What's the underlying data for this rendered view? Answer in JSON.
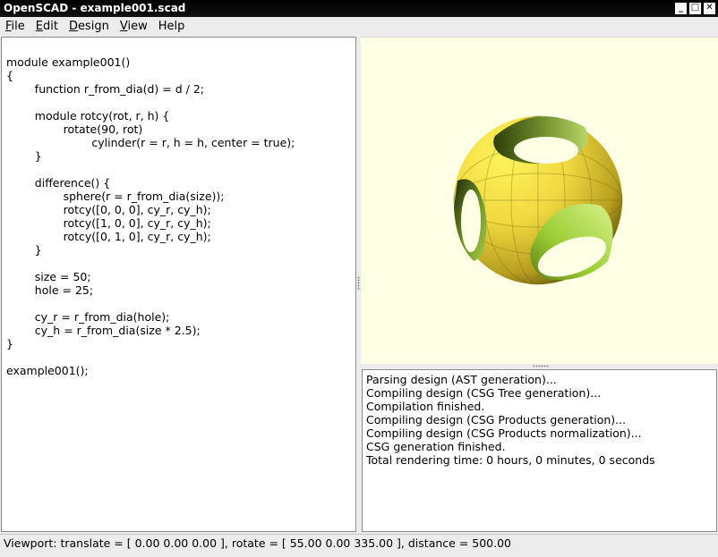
{
  "window": {
    "title": "OpenSCAD - example001.scad"
  },
  "window_controls": {
    "minimize": "_",
    "maximize": "□",
    "close": "✕"
  },
  "menu": [
    {
      "underline": "F",
      "rest": "ile"
    },
    {
      "underline": "E",
      "rest": "dit"
    },
    {
      "underline": "D",
      "rest": "esign"
    },
    {
      "underline": "V",
      "rest": "iew"
    },
    {
      "underline": "",
      "rest": "Help"
    }
  ],
  "editor": {
    "lines": [
      "module example001()",
      "{",
      "        function r_from_dia(d) = d / 2;",
      "",
      "        module rotcy(rot, r, h) {",
      "                rotate(90, rot)",
      "                        cylinder(r = r, h = h, center = true);",
      "        }",
      "",
      "        difference() {",
      "                sphere(r = r_from_dia(size));",
      "                rotcy([0, 0, 0], cy_r, cy_h);",
      "                rotcy([1, 0, 0], cy_r, cy_h);",
      "                rotcy([0, 1, 0], cy_r, cy_h);",
      "        }",
      "",
      "        size = 50;",
      "        hole = 25;",
      "",
      "        cy_r = r_from_dia(hole);",
      "        cy_h = r_from_dia(size * 2.5);",
      "}",
      "",
      "example001();"
    ]
  },
  "console": {
    "lines": [
      "Parsing design (AST generation)...",
      "Compiling design (CSG Tree generation)...",
      "Compilation finished.",
      "Compiling design (CSG Products generation)...",
      "Compiling design (CSG Products normalization)...",
      "CSG generation finished.",
      "Total rendering time: 0 hours, 0 minutes, 0 seconds"
    ]
  },
  "viewport": {
    "background": "#ffffe5",
    "model_colors": {
      "surface_light": "#f7e64a",
      "surface_dark": "#8a7a10",
      "hole_green": "#9acd32",
      "hole_dark": "#3d5a12"
    }
  },
  "status": {
    "text": "Viewport: translate = [ 0.00 0.00 0.00 ], rotate = [ 55.00 0.00 335.00 ], distance = 500.00"
  }
}
